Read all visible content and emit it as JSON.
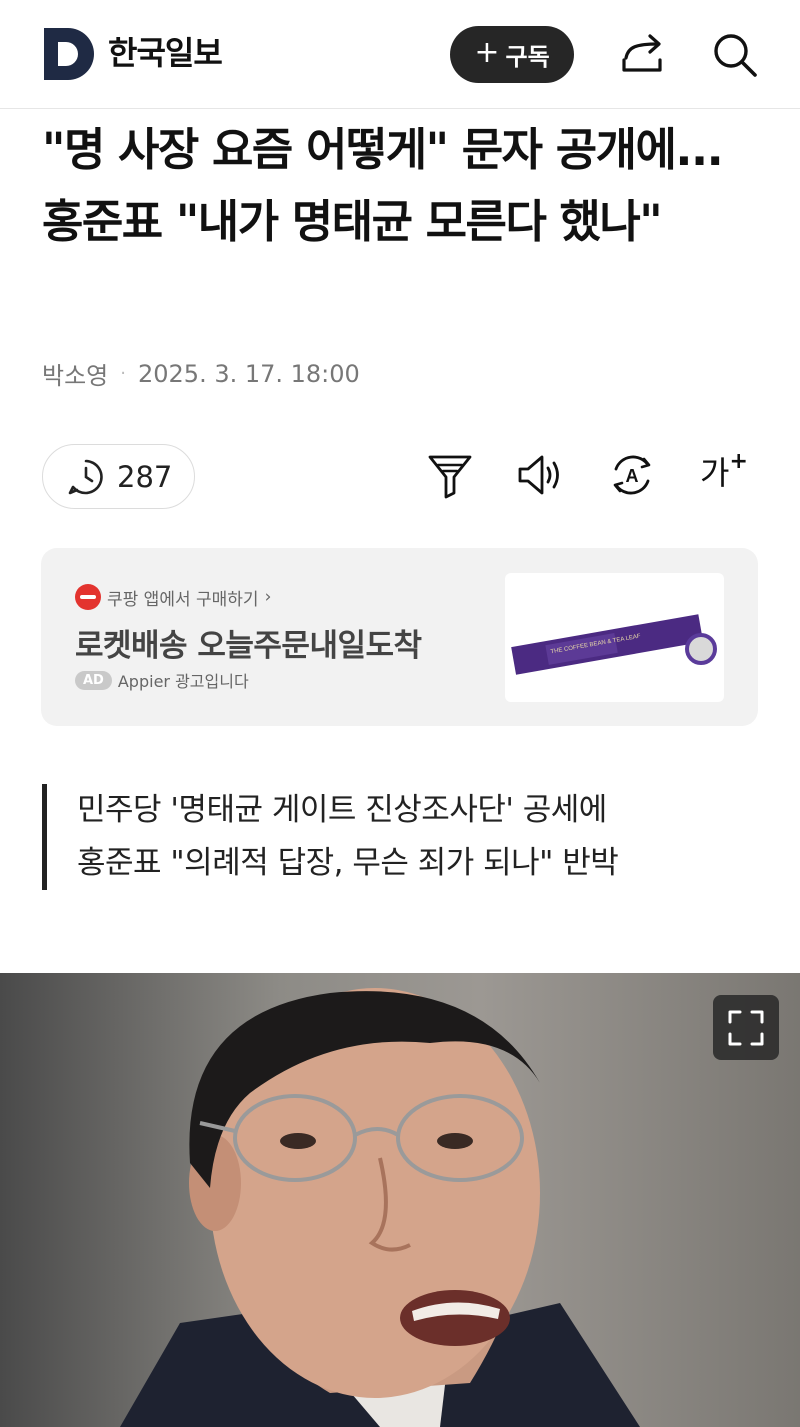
{
  "header": {
    "logo_letter": "D",
    "brand": "한국일보",
    "subscribe_plus": "+",
    "subscribe_label": "구독"
  },
  "article": {
    "headline": "\"명 사장 요즘 어떻게\" 문자 공개에... 홍준표 \"내가 명태균 모른다 했나\"",
    "author": "박소영",
    "meta_separator": "·",
    "datetime": "2025. 3. 17. 18:00",
    "comment_count": "287",
    "font_tool_label": "가",
    "font_tool_plus": "+",
    "summary_line1": "민주당 '명태균 게이트 진상조사단' 공세에",
    "summary_line2": "홍준표 \"의례적 답장, 무슨 죄가 되나\" 반박"
  },
  "ad": {
    "source": "쿠팡 앱에서 구매하기",
    "source_chevron": "›",
    "title": "로켓배송 오늘주문내일도착",
    "badge": "AD",
    "note": "Appier 광고입니다",
    "product_text": "THE COFFEE BEAN & TEA LEAF"
  },
  "icons": {
    "share": "share-icon",
    "search": "search-icon",
    "comment": "comment-clock-icon",
    "filter": "filter-icon",
    "speaker": "speaker-icon",
    "translate": "translate-icon",
    "expand": "expand-icon"
  },
  "colors": {
    "subscribe_bg": "#262626",
    "logo_navy": "#1f2a44",
    "ad_bg": "#f2f2f2",
    "coupang_red": "#e3342f",
    "product_purple": "#4b2a82"
  }
}
